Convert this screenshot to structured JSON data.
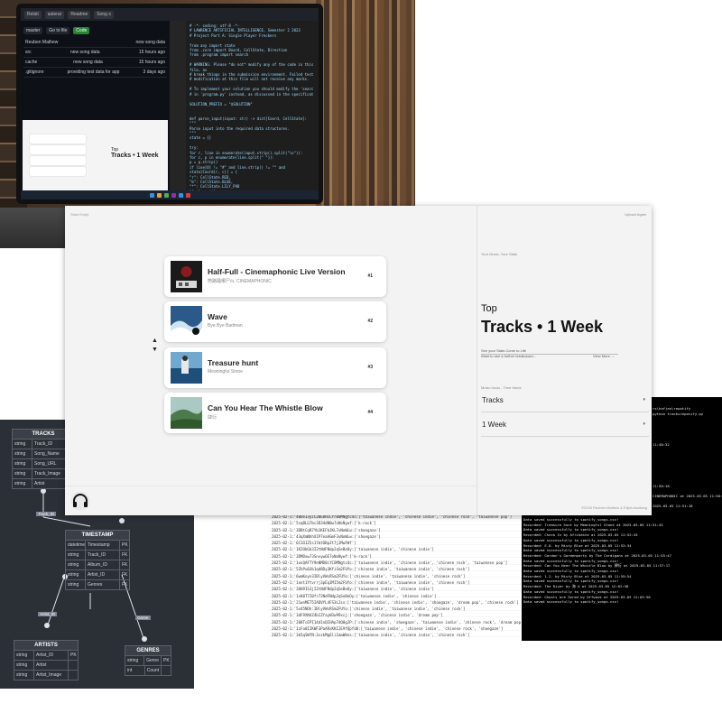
{
  "app": {
    "brand": "Stats.Expty",
    "upload_again": "Upload Again",
    "tagline": "Your Music, Your Stats",
    "heading_top": "Top",
    "heading_main": "Tracks • 1 Week",
    "see_stats": "See your Stats Come to Life",
    "breakdown": "Want to see a further breakdown...",
    "view_more": "View More →",
    "music_focus_label": "Music focus - Time frame",
    "focus_select": "Tracks",
    "timeframe_select": "1 Week",
    "copyright": "©2025 Reuben Mathew & Elijah Awdiang",
    "up_arrow": "▲",
    "down_arrow": "▼",
    "tracks": [
      {
        "title": "Half-Full - Cinemaphonic Live Version",
        "artist": "筒路睡哪尸/ʊ, CINEMAPHONIC",
        "rank": "#1"
      },
      {
        "title": "Wave",
        "artist": "Bye Bye Badman",
        "rank": "#2"
      },
      {
        "title": "Treasure hunt",
        "artist": "Meaningful Stone",
        "rank": "#3"
      },
      {
        "title": "Can You Hear The Whistle Blow",
        "artist": "肆衍",
        "rank": "#4"
      }
    ]
  },
  "laptop": {
    "tabs": [
      "Relati",
      "asterar",
      "Readme",
      "Song s"
    ],
    "branch": "master",
    "go_to_file": "Go to file",
    "code": "Code",
    "contribute": "Contribute",
    "commit_user": "Reuben Mathew",
    "commit_msg": "new song data",
    "files": [
      {
        "name": "src",
        "msg": "new song data",
        "when": "15 hours ago"
      },
      {
        "name": "cache",
        "msg": "new song data",
        "when": "15 hours ago"
      },
      {
        "name": ".gitignore",
        "msg": "providing test data for app",
        "when": "3 days ago"
      }
    ],
    "mini_top": "Top",
    "mini_title": "Tracks • 1 Week",
    "code_lines": [
      "# -*- coding: utf-8 -*-",
      "# LAWRENCE ARTIFICIAL INTELLIGENCE, Semester 2 2023",
      "# Project Part A: Single Player Freckers",
      "",
      "from any import state",
      "from .core import Board, CellState, Direction",
      "from .program import search",
      "",
      "# WARNING: Please *do not* modify any of the code in this file, as",
      "#          break things in the submission environment. Failed test",
      "#          modification at this file will not receive any marks.",
      "",
      "#          To implement your solution you should modify the 'searc",
      "#          in 'program.py' instead, as discussed in the specificat",
      "",
      "SOLUTION_PREFIX = \"$SOLUTION\"",
      "",
      "",
      "def parse_input(input: str) -> dict[Coord, CellState]:",
      "    \"\"\"",
      "    Parse input into the required data structures.",
      "    \"\"\"",
      "    state = {}",
      "",
      "    try:",
      "        for r, line in enumerate(input.strip().split(\"\\n\")):",
      "            for c, p in enumerate(line.split(\" \")):",
      "                p = p.strip()",
      "                if line[0] != \"#\" and line.strip() != \"\" and",
      "                    state[Coord(r, c)] = {",
      "                        \"r\": CellState.RED,",
      "                        \"b\": CellState.BLUE,",
      "                        \"*\": CellState.LILY_PAD",
      "                    }[p.lower()]",
      "",
      "        return state",
      "",
      "    except Exception as e:",
      "        print(f\"Error parsing input: {e}\")",
      "        exit(1)"
    ]
  },
  "er": {
    "tables": [
      {
        "name": "TRACKS",
        "rows": [
          [
            "string",
            "Track_ID"
          ],
          [
            "string",
            "Song_Name"
          ],
          [
            "string",
            "Song_URL"
          ],
          [
            "string",
            "Track_Image"
          ],
          [
            "string",
            "Artist"
          ]
        ]
      },
      {
        "name": "TIMESTAMP",
        "rows": [
          [
            "datetime",
            "Timestamp",
            "PK"
          ],
          [
            "string",
            "Track_ID",
            "FK"
          ],
          [
            "string",
            "Album_ID",
            "FK"
          ],
          [
            "string",
            "Artist_ID",
            "FK"
          ],
          [
            "string",
            "Genres",
            "FK"
          ]
        ]
      },
      {
        "name": "ARTISTS",
        "rows": [
          [
            "string",
            "Artist_ID",
            "PK"
          ],
          [
            "string",
            "Artist",
            ""
          ],
          [
            "string",
            "Artist_Image",
            ""
          ]
        ]
      },
      {
        "name": "GENRES",
        "rows": [
          [
            "string",
            "Genre",
            "PK"
          ],
          [
            "int",
            "Count",
            ""
          ]
        ]
      }
    ],
    "labels": [
      "Track_ID",
      "Artist_ID",
      "Genre"
    ]
  },
  "csv_lines": [
    "2025-02-1:'4BUeI3yiC2BE0HcLYrB0MNgtc4c:['taiwanese indie', 'chinese indie', 'chinese rock', 'taiwanese pop']",
    "2025-02-1:'5cqBLG7bc3D34dN0w7oNoNywf:['k-rock']",
    "2025-02-1:'3DBtCqR7Yb1KEFbJKL7vNoWLw:['shoegaze']",
    "2025-02-1:'43qXmNhhX1P7eaAGmF3vNoWLw:['shoegaze']",
    "2025-02-1:'6CIOIZ5s17mtOBpZt7j2MwFWf']",
    "2025-02-1:'1K2ObGb3I2tNdFNdp2qSeBeOy:['taiwanese indie', 'chinese indie']",
    "2025-02-1:'3DMOxw73SnvywOE7oNoNywf:['k-rock']",
    "2025-02-1:'1ovQAFTY9eNMD8iYCOMNgtc4c:['taiwanese indie', 'chinese indie', 'chinese rock', 'taiwanese pop']",
    "2025-02-1:'5ZhPu03b1qd8Dy3KfiSm2FUYo:['chinese indie', 'taiwanese indie', 'chinese rock']",
    "2025-02-1:'6wmKnyn3IBlyVWsRSm2FUYo:['chinese indie', 'taiwanese indie', 'chinese rock']",
    "2025-02-1:'1nnt1Ytvrrj3pEqIMI5m2FUYo:['chinese indie', 'taiwanese indie', 'chinese rock']",
    "2025-02-1:'3OH9IS3jI2tNdFNdp2qSeBeOy:['taiwanese indie', 'chinese indie']",
    "2025-02-1:'1sK0T7I0fr72NdFNdp2qSeBeOy:['taiwanese indie', 'chinese indie']",
    "2025-02-1:'21wnMET5IADVYL4FS3L2sv:['taiwanese indie', 'chinese indie', 'shoegaze', 'dream pop', 'chinese rock']",
    "2025-02-1:'5x45NOh:IBlyVWsRSm2FUYo:['chinese indie', 'taiwanese indie', 'chinese rock']",
    "2025-02-1:'3dF9XN4Z4bIZYayW3w99xcj:['shoegaze', 'chinese indie', 'dream pop']",
    "2025-02-1:'26KTcEPI14d1nQIHAp7dQ0gJP:['chinese indie', 'shoegaze', 'taiwanese indie', 'chinese rock', 'dream pop']",
    "2025-02-1:'1zFa0IIKWF3PaARsKKI2E9fQpfd0:['taiwanese indie', 'chinese indie', 'chinese rock', 'shoegaze']",
    "2025-02-1:'3k5qSWfN:3szkMg6li1maWbns:['taiwanese indie', 'chinese indie', 'chinese rock']"
  ],
  "terminal": {
    "upper_lines": [
      "rs\\hafjan\\repotify",
      "python tracksrepotify.py",
      "",
      "",
      "",
      "",
      "",
      "11:48:32",
      "",
      "",
      "",
      "",
      "",
      "",
      "",
      "11:50:18",
      "",
      "CINEMAPHONIC at 2025-03-05 11:50:44",
      "",
      "2025-03-05 11:51:18"
    ],
    "lower_lines": [
      "Data saved successfully to spotify_songs.csv!",
      "Recorded: Treasure hunt by Meaningful Stone at 2025-03-05 11:51:43",
      "Data saved successfully to spotify_songs.csv!",
      "Recorded: Check In by Afrikasta at 2025-03-05 11:52:43",
      "Data saved successfully to spotify_songs.csv!",
      "Recorded: E.D. by Misty Blue at 2025-03-05 11:53:34",
      "Data saved successfully to spotify_songs.csv!",
      "Recorded: Gordon's Gardenparty by The Cardigans at 2025-03-05 11:55:47",
      "Data saved successfully to spotify_songs.csv!",
      "Recorded: Can You Hear The Whistle Blow by 肆衍 at 2025-03-05 11:57:17",
      "Data saved successfully to spotify_songs.csv!",
      "Recorded: 1.2. by Misty Blue at 2025-03-05 11:59:54",
      "Data saved successfully to spotify_songs.csv!",
      "Recorded: The River by 海 A at 2025-03-05 12:02:36",
      "Data saved successfully to spotify_songs.csv!",
      "Recorded: Ghosts are Sored by Offwave at 2025-03-05 12:03:50",
      "Data saved successfully to spotify_songs.csv!"
    ]
  }
}
